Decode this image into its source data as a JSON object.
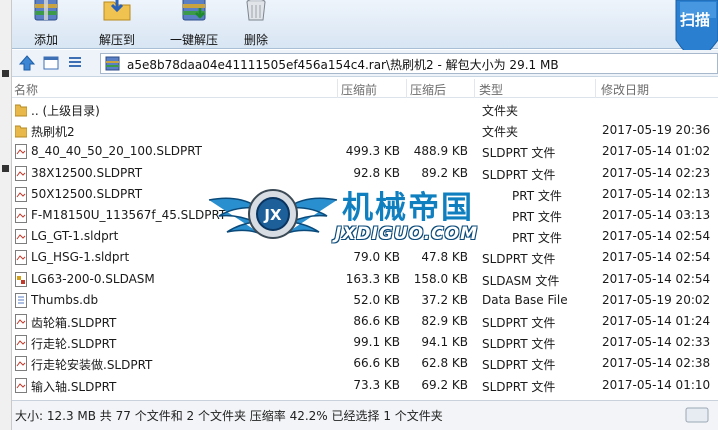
{
  "toolbar": {
    "add_label": "添加",
    "extract_label": "解压到",
    "oneclick_label": "一键解压",
    "delete_label": "删除",
    "scan_label": "扫描"
  },
  "address": {
    "path": "a5e8b78daa04e41111505ef456a154c4.rar\\热刷机2 - 解包大小为 29.1 MB"
  },
  "columns": {
    "name": "名称",
    "size": "压缩前",
    "packed": "压缩后",
    "type": "类型",
    "modified": "修改日期"
  },
  "files": [
    {
      "icon": "folder-up-icon",
      "name": ".. (上级目录)",
      "size": "",
      "packed": "",
      "type": "文件夹",
      "date": ""
    },
    {
      "icon": "folder-icon",
      "name": "热刷机2",
      "size": "",
      "packed": "",
      "type": "文件夹",
      "date": "2017-05-19 20:36"
    },
    {
      "icon": "sldprt-file-icon",
      "name": "8_40_40_50_20_100.SLDPRT",
      "size": "499.3 KB",
      "packed": "488.9 KB",
      "type": "SLDPRT 文件",
      "date": "2017-05-14 01:02"
    },
    {
      "icon": "sldprt-file-icon",
      "name": "38X12500.SLDPRT",
      "size": "92.8 KB",
      "packed": "89.2 KB",
      "type": "SLDPRT 文件",
      "date": "2017-05-14 02:23"
    },
    {
      "icon": "sldprt-file-icon",
      "name": "50X12500.SLDPRT",
      "size": "",
      "packed": "",
      "type": "PRT 文件",
      "date": "2017-05-14 02:13"
    },
    {
      "icon": "sldprt-file-icon",
      "name": "F-M18150U_113567f_45.SLDPRT",
      "size": "",
      "packed": "",
      "type": "PRT 文件",
      "date": "2017-05-14 03:13"
    },
    {
      "icon": "sldprt-file-icon",
      "name": "LG_GT-1.sldprt",
      "size": "",
      "packed": "",
      "type": "PRT 文件",
      "date": "2017-05-14 02:54"
    },
    {
      "icon": "sldprt-file-icon",
      "name": "LG_HSG-1.sldprt",
      "size": "79.0 KB",
      "packed": "47.8 KB",
      "type": "SLDPRT 文件",
      "date": "2017-05-14 02:54"
    },
    {
      "icon": "sldasm-file-icon",
      "name": "LG63-200-0.SLDASM",
      "size": "163.3 KB",
      "packed": "158.0 KB",
      "type": "SLDASM 文件",
      "date": "2017-05-14 02:54"
    },
    {
      "icon": "db-file-icon",
      "name": "Thumbs.db",
      "size": "52.0 KB",
      "packed": "37.2 KB",
      "type": "Data Base File",
      "date": "2017-05-19 20:02"
    },
    {
      "icon": "sldprt-file-icon",
      "name": "齿轮箱.SLDPRT",
      "size": "86.6 KB",
      "packed": "82.9 KB",
      "type": "SLDPRT 文件",
      "date": "2017-05-14 01:24"
    },
    {
      "icon": "sldprt-file-icon",
      "name": "行走轮.SLDPRT",
      "size": "99.1 KB",
      "packed": "94.1 KB",
      "type": "SLDPRT 文件",
      "date": "2017-05-14 02:33"
    },
    {
      "icon": "sldprt-file-icon",
      "name": "行走轮安装做.SLDPRT",
      "size": "66.6 KB",
      "packed": "62.8 KB",
      "type": "SLDPRT 文件",
      "date": "2017-05-14 02:38"
    },
    {
      "icon": "sldprt-file-icon",
      "name": "输入轴.SLDPRT",
      "size": "73.3 KB",
      "packed": "69.2 KB",
      "type": "SLDPRT 文件",
      "date": "2017-05-14 01:10"
    }
  ],
  "watermark": {
    "title": "机械帝国",
    "url": "JXDIGUO.COM",
    "badge": "JX"
  },
  "status": {
    "text": "大小: 12.3 MB 共 77 个文件和 2 个文件夹 压缩率 42.2% 已经选择 1 个文件夹"
  },
  "colors": {
    "toolbar_bg": "#dbe7f4",
    "accent_blue": "#0f7fbf",
    "folder_yellow": "#e8b84a"
  }
}
